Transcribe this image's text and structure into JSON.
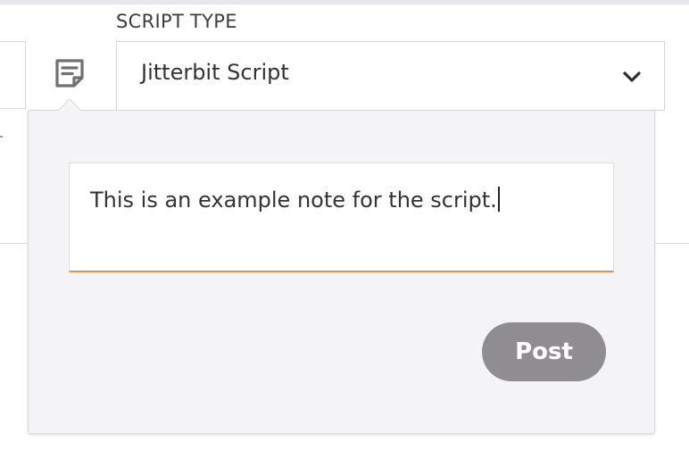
{
  "script_type": {
    "label": "SCRIPT TYPE",
    "selected_value": "Jitterbit Script",
    "dropdown_icon": "chevron-down-icon"
  },
  "notes": {
    "toggle_icon": "note-icon",
    "note_text": "This is an example note for the script.",
    "post_label": "Post"
  },
  "colors": {
    "field_underline_active": "#f08c4a",
    "post_button_bg": "#8f8d92",
    "popover_bg": "#f4f4f6",
    "note_icon": "#6f6f74"
  }
}
